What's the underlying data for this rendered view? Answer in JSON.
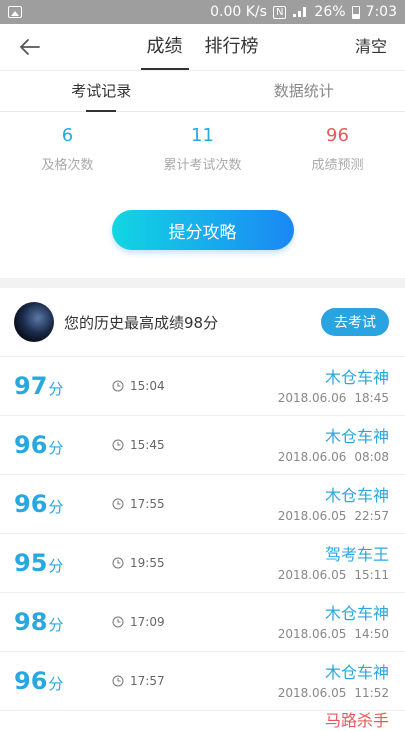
{
  "status_bar": {
    "speed": "0.00 K/s",
    "nfc_letter": "N",
    "battery": "26%",
    "time": "7:03"
  },
  "nav": {
    "tabs": [
      {
        "label": "成绩",
        "active": true
      },
      {
        "label": "排行榜",
        "active": false
      }
    ],
    "clear_label": "清空"
  },
  "subtabs": [
    {
      "label": "考试记录",
      "active": true
    },
    {
      "label": "数据统计",
      "active": false
    }
  ],
  "stats": [
    {
      "value": "6",
      "label": "及格次数",
      "color": "#29a8e0"
    },
    {
      "value": "11",
      "label": "累计考试次数",
      "color": "#29a8e0"
    },
    {
      "value": "96",
      "label": "成绩预测",
      "color": "#e45a5a"
    }
  ],
  "cta_label": "提分攻略",
  "best": {
    "text": "您的历史最高成绩98分",
    "button": "去考试"
  },
  "records": [
    {
      "score": "97",
      "unit": "分",
      "duration": "15:04",
      "title": "木仓车神",
      "date": "2018.06.06",
      "time": "18:45"
    },
    {
      "score": "96",
      "unit": "分",
      "duration": "15:45",
      "title": "木仓车神",
      "date": "2018.06.06",
      "time": "08:08"
    },
    {
      "score": "96",
      "unit": "分",
      "duration": "17:55",
      "title": "木仓车神",
      "date": "2018.06.05",
      "time": "22:57"
    },
    {
      "score": "95",
      "unit": "分",
      "duration": "19:55",
      "title": "驾考车王",
      "date": "2018.06.05",
      "time": "15:11"
    },
    {
      "score": "98",
      "unit": "分",
      "duration": "17:09",
      "title": "木仓车神",
      "date": "2018.06.05",
      "time": "14:50"
    },
    {
      "score": "96",
      "unit": "分",
      "duration": "17:57",
      "title": "木仓车神",
      "date": "2018.06.05",
      "time": "11:52"
    }
  ],
  "partial_next_title": "马路杀手",
  "colors": {
    "accent": "#29a8e0",
    "prediction": "#e45a5a",
    "button_gradient_start": "#12d6e2",
    "button_gradient_end": "#1b87f5"
  }
}
